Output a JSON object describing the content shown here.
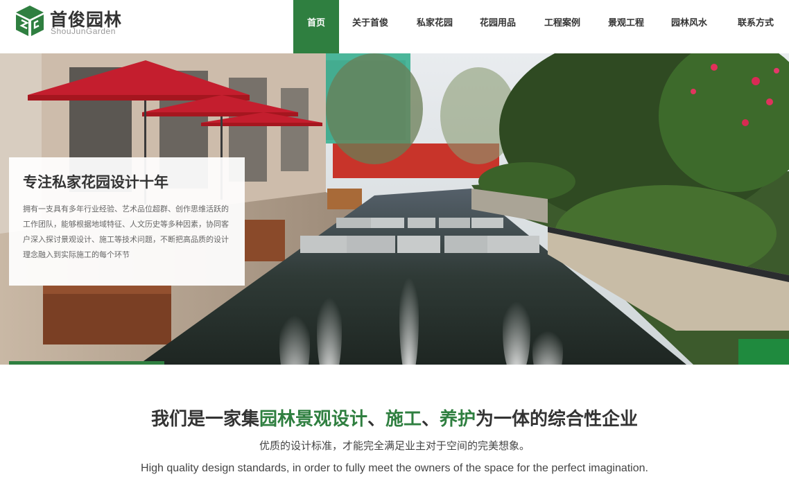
{
  "brand": {
    "name_cn": "首俊园林",
    "name_en": "ShouJunGarden",
    "color": "#2f7f40"
  },
  "nav": {
    "items": [
      {
        "label": "首页",
        "active": true
      },
      {
        "label": "关于首俊",
        "active": false
      },
      {
        "label": "私家花园",
        "active": false
      },
      {
        "label": "花园用品",
        "active": false
      },
      {
        "label": "工程案例",
        "active": false
      },
      {
        "label": "景观工程",
        "active": false
      },
      {
        "label": "园林风水",
        "active": false
      },
      {
        "label": "联系方式",
        "active": false
      }
    ]
  },
  "hero": {
    "title": "专注私家花园设计十年",
    "description": "拥有一支具有多年行业经验、艺术品位超群、创作思维活跃的工作团队，能够根据地域特征、人文历史等多种因素，协同客户深入探讨景观设计、施工等技术问题，不断把高品质的设计理念融入到实际施工的每个环节",
    "image": "rooftop-garden-pool-photo"
  },
  "intro": {
    "heading_parts": [
      {
        "text": "我们是一家集",
        "highlight": false
      },
      {
        "text": "园林景观设计",
        "highlight": true
      },
      {
        "text": "、",
        "highlight": false
      },
      {
        "text": "施工",
        "highlight": true
      },
      {
        "text": "、",
        "highlight": false
      },
      {
        "text": "养护",
        "highlight": true
      },
      {
        "text": "为一体的综合性企业",
        "highlight": false
      }
    ],
    "subtitle_cn": "优质的设计标准，才能完全满足业主对于空间的完美想象。",
    "subtitle_en": "High quality design standards, in order to fully meet the owners of the space for the perfect imagination."
  }
}
